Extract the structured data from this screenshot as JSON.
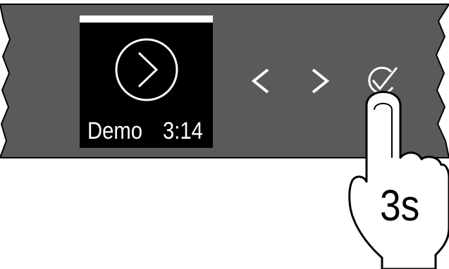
{
  "panel": {
    "colors": {
      "panel": "#5a5a5a",
      "display_bg": "#000000",
      "display_fg": "#ffffff",
      "hand_fill": "#ffffff",
      "outline": "#000000"
    }
  },
  "display": {
    "program_name": "Demo",
    "program_time": "3:14",
    "icon": "play-circle-icon"
  },
  "controls": {
    "prev_icon": "chevron-left-icon",
    "next_icon": "chevron-right-icon",
    "confirm_icon": "checkmark-circle-icon"
  },
  "instruction": {
    "hold_duration": "3s",
    "icon": "pointing-hand-icon"
  }
}
